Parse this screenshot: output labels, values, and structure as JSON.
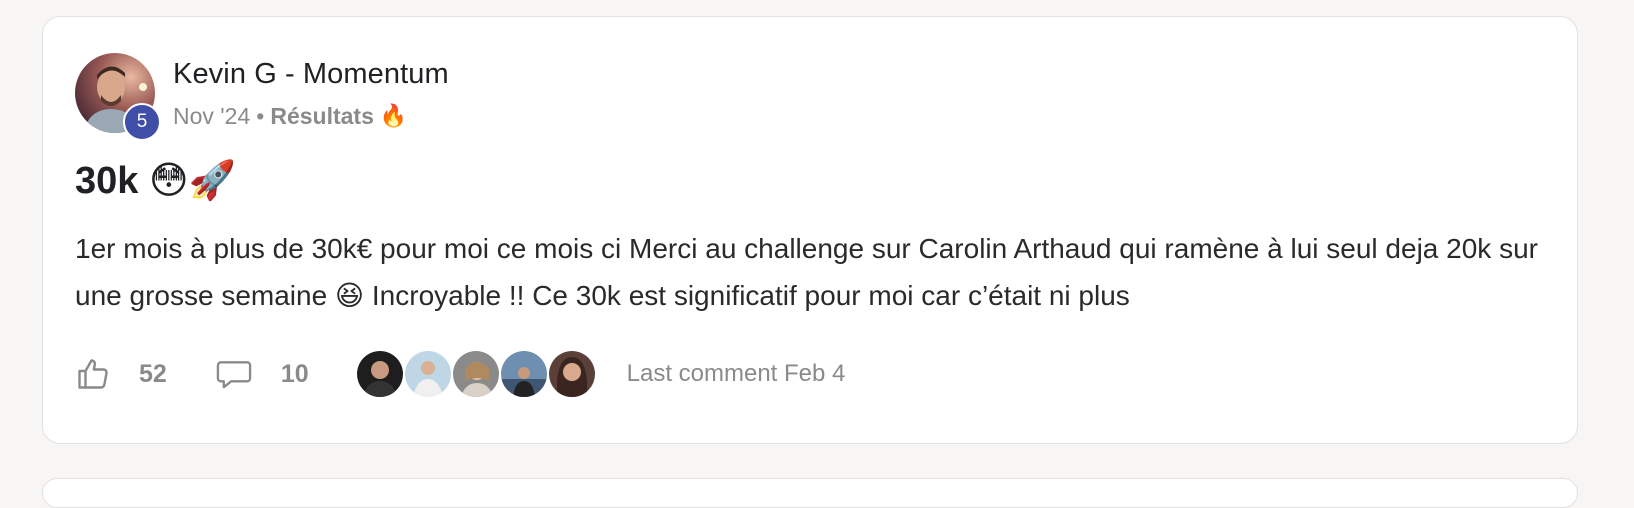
{
  "post": {
    "author_name": "Kevin G - Momentum",
    "level": "5",
    "date": "Nov '24",
    "separator": "•",
    "category": "Résultats",
    "category_emoji": "🔥",
    "title": "30k 😳🚀",
    "body": "1er mois à plus de 30k€ pour moi ce mois ci Merci au challenge sur Carolin Arthaud qui ramène à lui seul deja 20k sur une grosse semaine 😆 Incroyable !! Ce 30k est significatif pour moi car c’était ni plus",
    "likes_count": "52",
    "comments_count": "10",
    "last_comment": "Last comment Feb 4",
    "icons": {
      "like": "thumbs-up-icon",
      "comment": "comment-bubble-icon"
    },
    "colors": {
      "level_badge": "#3f4fa8",
      "muted_text": "#8a8a8a"
    }
  }
}
